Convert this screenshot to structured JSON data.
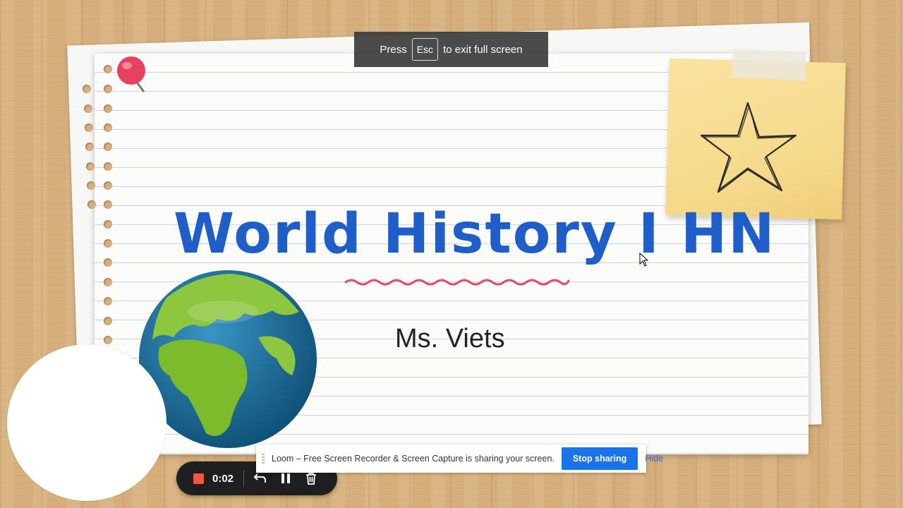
{
  "fullscreen_notice": {
    "press": "Press",
    "key": "Esc",
    "suffix": "to exit full screen"
  },
  "slide": {
    "title": "World History I HN",
    "subtitle": "Ms. Viets",
    "colors": {
      "title": "#1f5ec8",
      "squiggle": "#e04a62",
      "pin": "#e8415f",
      "sticky": "#f6d98a"
    },
    "icons": [
      "push-pin-icon",
      "star-doodle-icon",
      "globe-icon"
    ]
  },
  "recorder": {
    "elapsed": "0:02",
    "icons": [
      "stop-record-icon",
      "undo-icon",
      "pause-icon",
      "trash-icon"
    ],
    "accent": "#f05a3c"
  },
  "share_bar": {
    "message": "Loom – Free Screen Recorder & Screen Capture is sharing your screen.",
    "stop_label": "Stop sharing",
    "hide_label": "Hide",
    "accent": "#1a73e8"
  }
}
